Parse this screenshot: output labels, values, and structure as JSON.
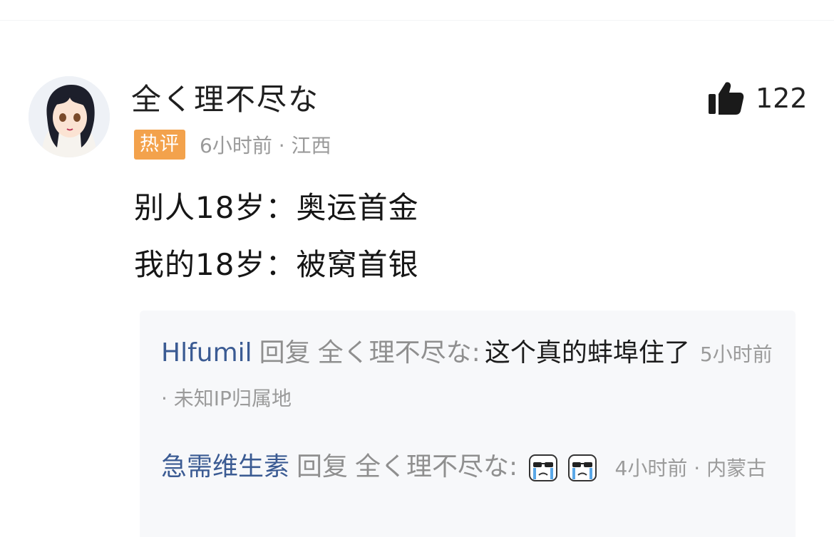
{
  "comment": {
    "username": "全く理不尽な",
    "likes": "122",
    "badge": "热评",
    "meta": "6小时前 · 江西",
    "lines": [
      "别人18岁：奥运首金",
      "我的18岁：被窝首银"
    ]
  },
  "replies": [
    {
      "user": "Hlfumil",
      "verb": "回复",
      "target": "全く理不尽な",
      "colon": ":",
      "text": "这个真的蚌埠住了",
      "meta": "5小时前 · 未知IP归属地"
    },
    {
      "user": "急需维生素",
      "verb": "回复",
      "target": "全く理不尽な",
      "colon": ":",
      "emojis": [
        "crying-emoji",
        "crying-emoji"
      ],
      "meta": "4小时前 · 内蒙古"
    }
  ],
  "colors": {
    "badge": "#f3a24c",
    "reply_user": "#3b5b93",
    "meta": "#9a9a9a"
  }
}
